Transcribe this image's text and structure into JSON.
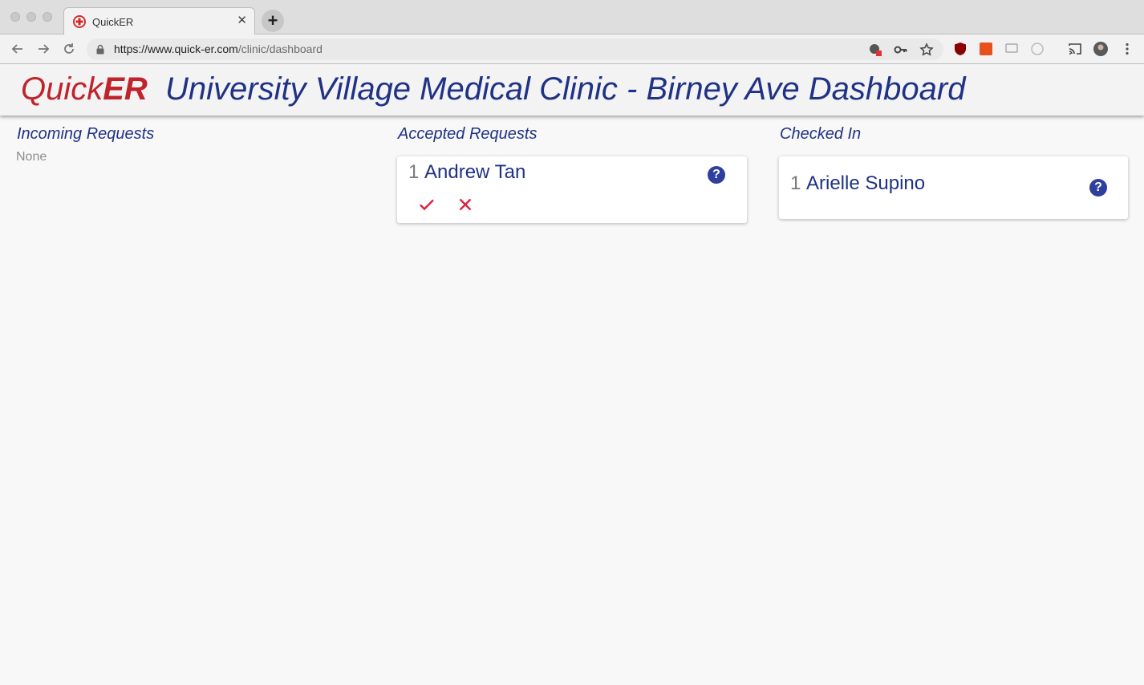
{
  "browser": {
    "tab_title": "QuickER",
    "tab_close": "✕",
    "new_tab": "+",
    "url_host": "https://www.quick-er.com",
    "url_path": "/clinic/dashboard"
  },
  "header": {
    "brand_light": "Quick",
    "brand_bold": "ER",
    "title": "University Village Medical Clinic - Birney Ave Dashboard"
  },
  "columns": {
    "incoming": {
      "title": "Incoming Requests",
      "empty": "None"
    },
    "accepted": {
      "title": "Accepted Requests",
      "items": [
        {
          "number": "1",
          "name": "Andrew Tan"
        }
      ]
    },
    "checked_in": {
      "title": "Checked In",
      "items": [
        {
          "number": "1",
          "name": "Arielle Supino"
        }
      ]
    }
  },
  "icons": {
    "help": "?"
  },
  "colors": {
    "brand_red": "#c0232b",
    "primary_navy": "#1f3285",
    "help_blue": "#2e3f9e",
    "action_red": "#e0203c"
  }
}
